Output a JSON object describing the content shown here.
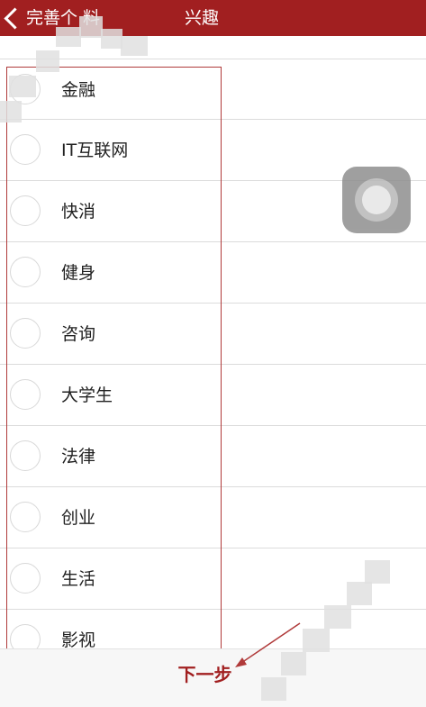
{
  "header": {
    "back_label": "完善个   料",
    "title": "兴趣"
  },
  "interests": [
    {
      "label": "金融"
    },
    {
      "label": "IT互联网"
    },
    {
      "label": "快消"
    },
    {
      "label": "健身"
    },
    {
      "label": "咨询"
    },
    {
      "label": "大学生"
    },
    {
      "label": "法律"
    },
    {
      "label": "创业"
    },
    {
      "label": "生活"
    },
    {
      "label": "影视"
    }
  ],
  "footer": {
    "next_label": "下一步"
  },
  "colors": {
    "header_bg": "#a11f20",
    "annotation_red": "#b03a3a"
  }
}
